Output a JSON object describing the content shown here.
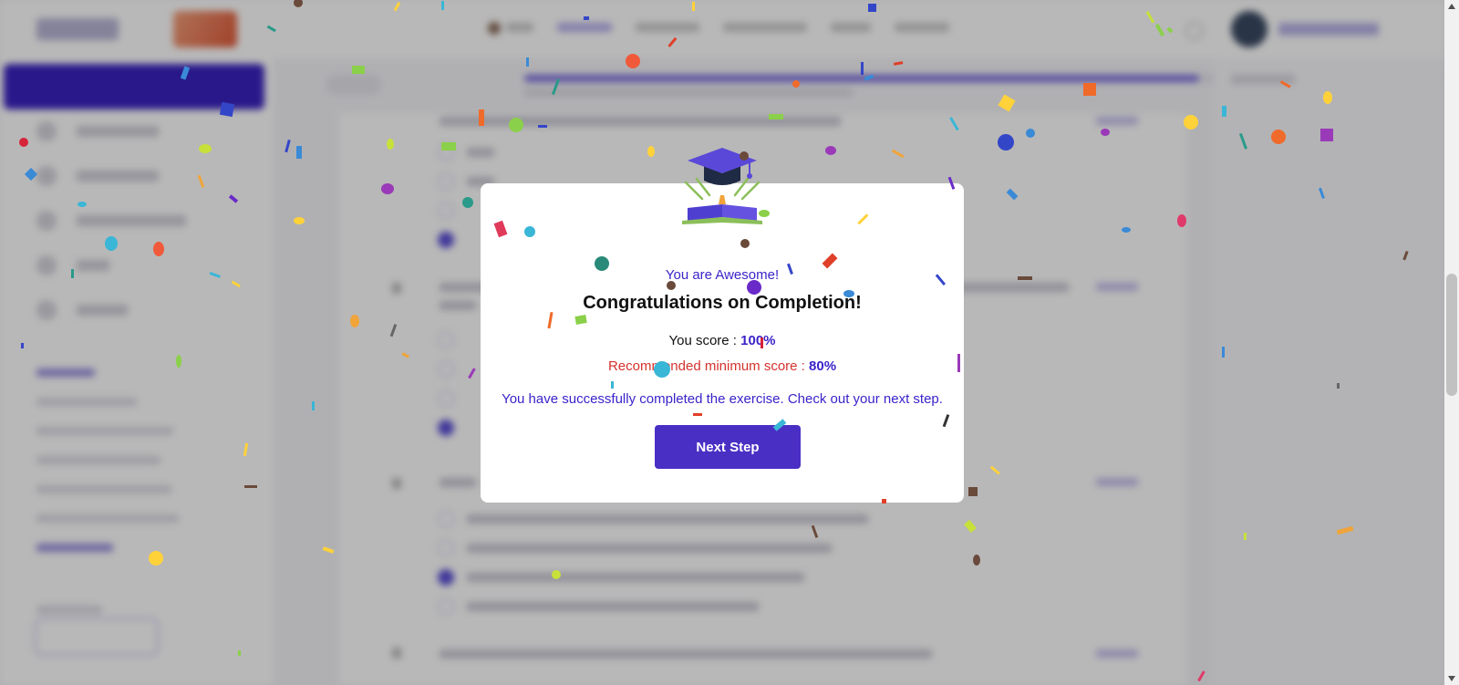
{
  "modal": {
    "subtitle": "You are Awesome!",
    "title": "Congratulations on Completion!",
    "score_label": "You score : ",
    "score_value": "100%",
    "min_score_label": "Recommended minimum score : ",
    "min_score_value": "80%",
    "message": "You have successfully completed the exercise. Check out your next step.",
    "next_button": "Next Step"
  },
  "icons": {
    "illustration": "graduation-cap-book-icon"
  },
  "colors": {
    "accent": "#4a2fc4",
    "accent_text": "#3a24c9",
    "warning_text": "#d4322d",
    "overlay": "rgba(0,0,0,0.28)"
  }
}
